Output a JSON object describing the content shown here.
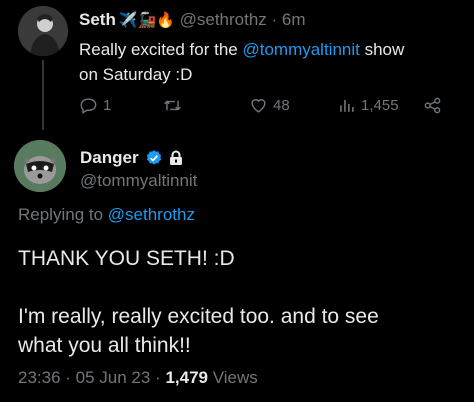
{
  "parent_tweet": {
    "name": "Seth",
    "name_emojis": "✈️🚂🔥",
    "handle": "@sethrothz",
    "time_sep": " · ",
    "time": "6m",
    "text_prefix": "Really excited for the ",
    "mention": "@tommyaltinnit",
    "text_suffix": " show",
    "text_line2": "on Saturday :D",
    "replies": "1",
    "likes": "48",
    "views": "1,455"
  },
  "main_tweet": {
    "name": "Danger",
    "handle": "@tommyaltinnit",
    "replying_label": "Replying to ",
    "replying_handle": "@sethrothz",
    "line1": "THANK YOU SETH! :D",
    "line2": "I'm really, really excited too. and to see",
    "line3": "what you all think!!",
    "time": "23:36 · 05 Jun 23 · ",
    "views_count": "1,479",
    "views_label": " Views"
  },
  "colors": {
    "accent": "#1d9bf0",
    "muted": "#71767b",
    "text": "#e7e9ea",
    "background": "#000000"
  },
  "icons": [
    "reply-icon",
    "retweet-icon",
    "like-icon",
    "views-icon",
    "share-icon",
    "verified-badge-icon",
    "lock-icon"
  ]
}
